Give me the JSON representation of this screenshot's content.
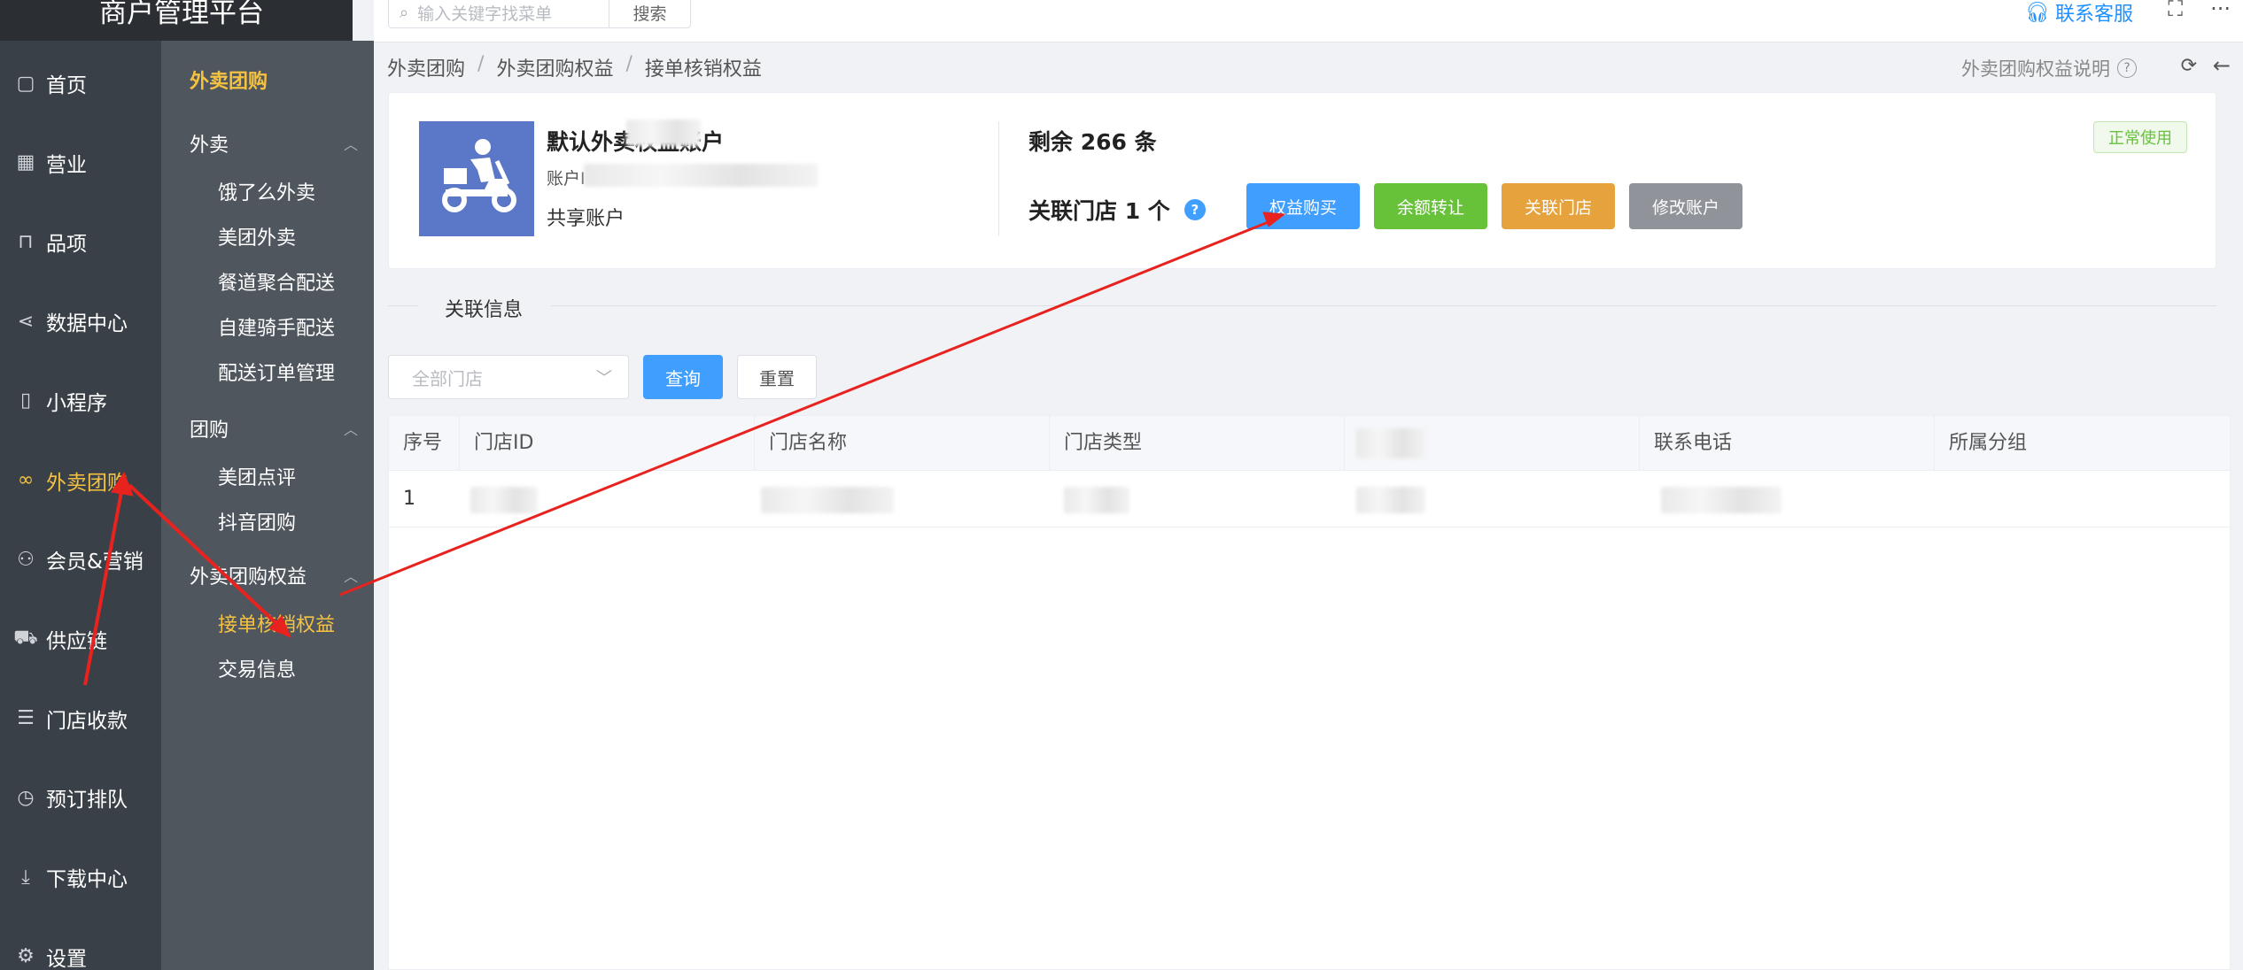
{
  "brand": "商户管理平台",
  "nav_main": [
    {
      "label": "首页",
      "icon": "home-icon",
      "glyph": "▢"
    },
    {
      "label": "营业",
      "icon": "calendar-icon",
      "glyph": "▦"
    },
    {
      "label": "品项",
      "icon": "bag-icon",
      "glyph": "⊓"
    },
    {
      "label": "数据中心",
      "icon": "share-icon",
      "glyph": "⋖"
    },
    {
      "label": "小程序",
      "icon": "phone-icon",
      "glyph": "▯"
    },
    {
      "label": "外卖团购",
      "icon": "bike-icon",
      "glyph": "∞",
      "active": true
    },
    {
      "label": "会员&营销",
      "icon": "user-icon",
      "glyph": "⚇"
    },
    {
      "label": "供应链",
      "icon": "truck-icon",
      "glyph": "⛟"
    },
    {
      "label": "门店收款",
      "icon": "coins-icon",
      "glyph": "☰"
    },
    {
      "label": "预订排队",
      "icon": "clock-icon",
      "glyph": "◷"
    },
    {
      "label": "下载中心",
      "icon": "download-icon",
      "glyph": "⤓"
    },
    {
      "label": "设置",
      "icon": "gear-icon",
      "glyph": "⚙"
    }
  ],
  "nav_sub": {
    "group_title": "外卖团购",
    "sections": [
      {
        "title": "外卖",
        "items": [
          "饿了么外卖",
          "美团外卖",
          "餐道聚合配送",
          "自建骑手配送",
          "配送订单管理"
        ]
      },
      {
        "title": "团购",
        "items": [
          "美团点评",
          "抖音团购"
        ]
      },
      {
        "title": "外卖团购权益",
        "items": [
          "接单核销权益",
          "交易信息"
        ]
      }
    ],
    "active_item": "接单核销权益"
  },
  "topbar": {
    "search_placeholder": "输入关键字找菜单",
    "search_button": "搜索",
    "service": "联系客服"
  },
  "breadcrumb": [
    "外卖团购",
    "外卖团购权益",
    "接单核销权益"
  ],
  "help_link": "外卖团购权益说明",
  "account": {
    "name": "默认外卖权益账户",
    "id_label": "账户I",
    "type": "共享账户",
    "remaining": "剩余 266 条",
    "linked_stores": "关联门店 1 个",
    "status": "正常使用",
    "buttons": {
      "buy": "权益购买",
      "transfer": "余额转让",
      "link_store": "关联门店",
      "edit": "修改账户"
    }
  },
  "section_title": "关联信息",
  "filters": {
    "store_select": "全部门店",
    "query": "查询",
    "reset": "重置"
  },
  "table": {
    "columns": [
      "序号",
      "门店ID",
      "门店名称",
      "门店类型",
      "",
      "联系电话",
      "所属分组"
    ],
    "rows": [
      [
        "1",
        "",
        "",
        "",
        "",
        "",
        ""
      ]
    ]
  },
  "colors": {
    "accent": "#f5c242",
    "primary": "#409eff",
    "success": "#67c23a",
    "warning": "#e6a23c",
    "info": "#909399",
    "annotation": "#e8231f"
  }
}
